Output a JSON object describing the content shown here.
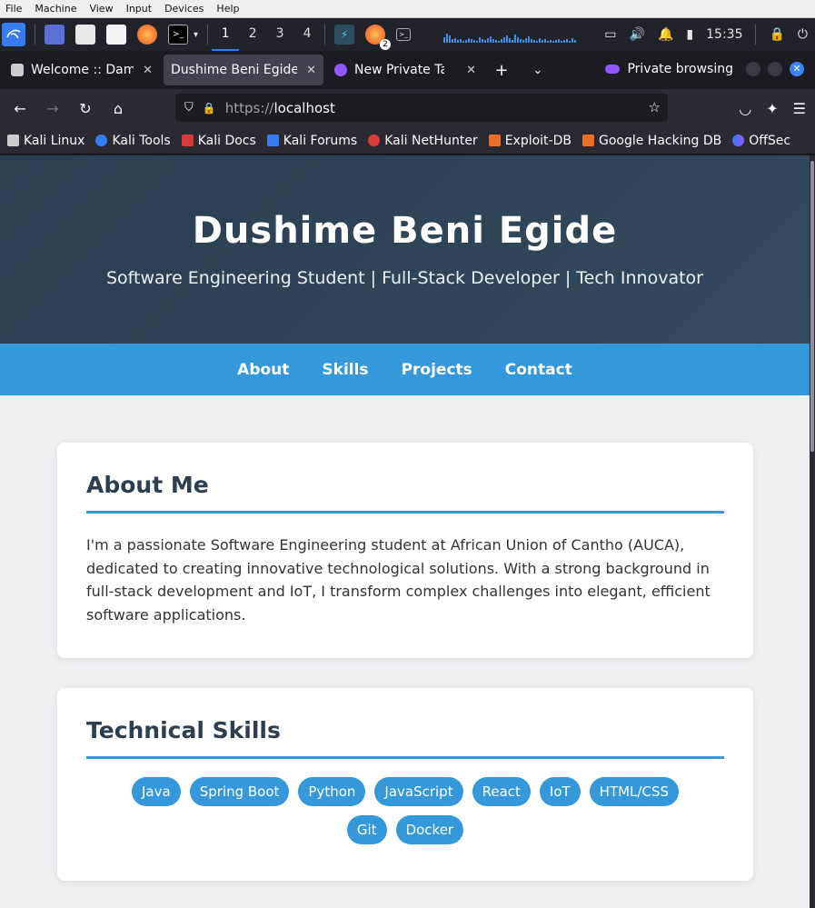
{
  "vm_menu": [
    "File",
    "Machine",
    "View",
    "Input",
    "Devices",
    "Help"
  ],
  "panel": {
    "workspaces": [
      "1",
      "2",
      "3",
      "4"
    ],
    "active_workspace": "1",
    "clock": "15:35",
    "firefox_badge": "2"
  },
  "tabs": [
    {
      "title": "Welcome :: Damn V",
      "active": false
    },
    {
      "title": "Dushime Beni Egide -",
      "active": true
    },
    {
      "title": "New Private Tab",
      "active": false
    }
  ],
  "private_label": "Private browsing",
  "url": {
    "scheme": "https://",
    "host": "localhost"
  },
  "bookmarks": [
    "Kali Linux",
    "Kali Tools",
    "Kali Docs",
    "Kali Forums",
    "Kali NetHunter",
    "Exploit-DB",
    "Google Hacking DB",
    "OffSec"
  ],
  "site": {
    "name": "Dushime Beni Egide",
    "tagline": "Software Engineering Student | Full-Stack Developer | Tech Innovator",
    "nav": [
      "About",
      "Skills",
      "Projects",
      "Contact"
    ],
    "about": {
      "heading": "About Me",
      "text": "I'm a passionate Software Engineering student at African Union of Cantho (AUCA), dedicated to creating innovative technological solutions. With a strong background in full-stack development and IoT, I transform complex challenges into elegant, efficient software applications."
    },
    "skills": {
      "heading": "Technical Skills",
      "items": [
        "Java",
        "Spring Boot",
        "Python",
        "JavaScript",
        "React",
        "IoT",
        "HTML/CSS",
        "Git",
        "Docker"
      ]
    }
  },
  "colors": {
    "hero": "#2c3e50",
    "accent": "#3498db"
  }
}
